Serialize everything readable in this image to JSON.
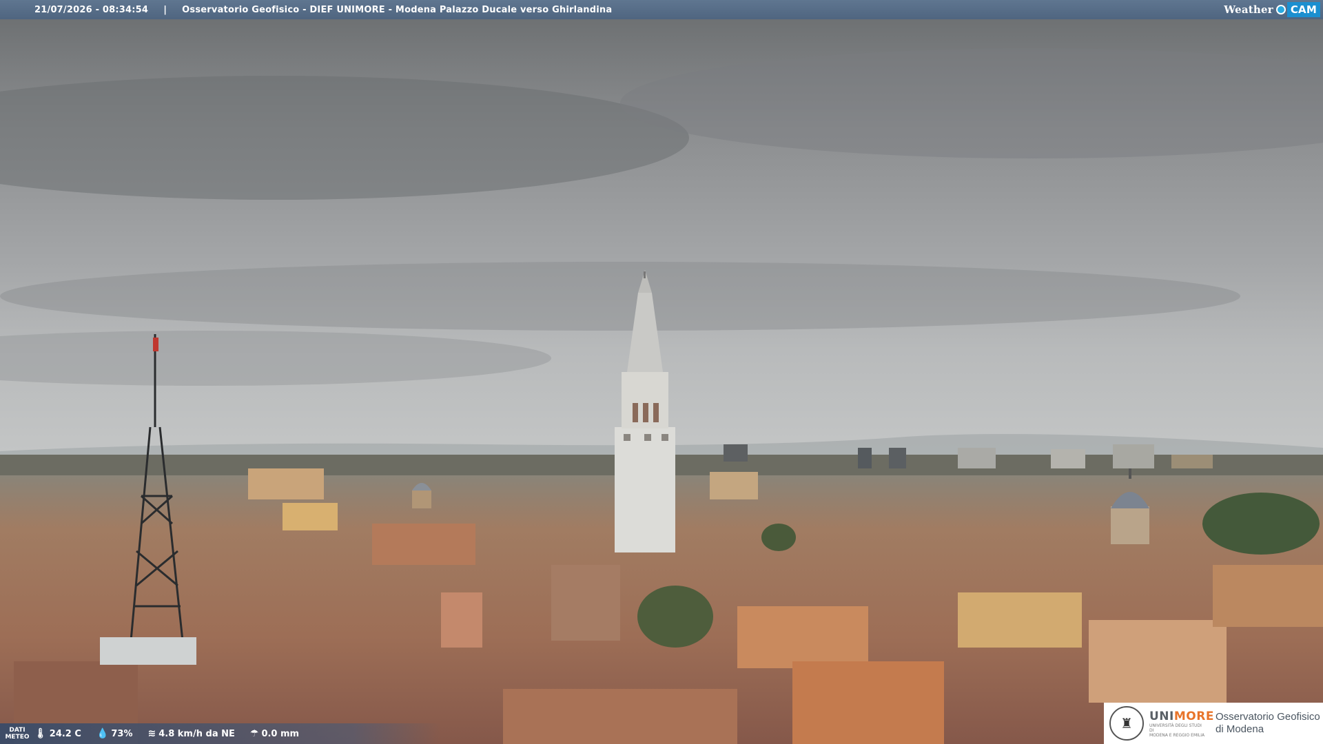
{
  "header": {
    "timestamp": "21/07/2026 - 08:34:54",
    "separator": "|",
    "title": "Osservatorio Geofisico - DIEF UNIMORE - Modena Palazzo Ducale verso Ghirlandina",
    "brand_weather": "Weather",
    "brand_cam": "CAM"
  },
  "meteo": {
    "label_line1": "DATI",
    "label_line2": "METEO",
    "temperature": "24.2 C",
    "humidity": "73%",
    "wind": "4.8 km/h da NE",
    "rain": "0.0 mm",
    "icons": [
      "thermometer-icon",
      "humidity-drop-icon",
      "wind-icon",
      "rain-icon"
    ]
  },
  "logo": {
    "uni_prefix": "UNI",
    "uni_suffix": "MORE",
    "uni_sub1": "UNIVERSITÀ DEGLI STUDI DI",
    "uni_sub2": "MODENA E REGGIO EMILIA",
    "obs_line1": "Osservatorio Geofisico",
    "obs_line2": "di Modena"
  },
  "colors": {
    "topbar": "#56708c",
    "accent_orange": "#e8742a",
    "roof": "#a86a50",
    "sky": "#9a9c9e"
  }
}
